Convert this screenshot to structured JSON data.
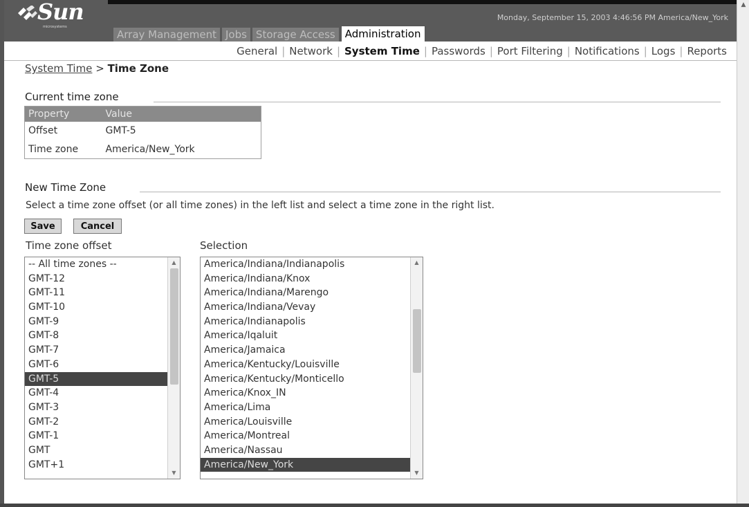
{
  "header": {
    "logo_text": "Sun",
    "logo_subtext": "microsystems",
    "datetime": "Monday, September 15, 2003 4:46:56 PM America/New_York"
  },
  "main_tabs": [
    {
      "label": "Array Management",
      "active": false
    },
    {
      "label": "Jobs",
      "active": false
    },
    {
      "label": "Storage Access",
      "active": false
    },
    {
      "label": "Administration",
      "active": true
    }
  ],
  "sub_tabs": [
    {
      "label": "General",
      "active": false
    },
    {
      "label": "Network",
      "active": false
    },
    {
      "label": "System Time",
      "active": true
    },
    {
      "label": "Passwords",
      "active": false
    },
    {
      "label": "Port Filtering",
      "active": false
    },
    {
      "label": "Notifications",
      "active": false
    },
    {
      "label": "Logs",
      "active": false
    },
    {
      "label": "Reports",
      "active": false
    }
  ],
  "breadcrumb": {
    "parent": "System Time",
    "separator": ">",
    "current": "Time Zone"
  },
  "current_tz": {
    "title": "Current time zone",
    "headers": [
      "Property",
      "Value"
    ],
    "rows": [
      [
        "Offset",
        "GMT-5"
      ],
      [
        "Time zone",
        "America/New_York"
      ]
    ]
  },
  "new_tz": {
    "title": "New Time Zone",
    "instructions": "Select a time zone offset (or all time zones) in the left list and select a time zone in the right list.",
    "save_label": "Save",
    "cancel_label": "Cancel",
    "offset_label": "Time zone offset",
    "selection_label": "Selection",
    "offsets": [
      "-- All time zones --",
      "GMT-12",
      "GMT-11",
      "GMT-10",
      "GMT-9",
      "GMT-8",
      "GMT-7",
      "GMT-6",
      "GMT-5",
      "GMT-4",
      "GMT-3",
      "GMT-2",
      "GMT-1",
      "GMT",
      "GMT+1"
    ],
    "selected_offset": "GMT-5",
    "zones": [
      "America/Indiana/Indianapolis",
      "America/Indiana/Knox",
      "America/Indiana/Marengo",
      "America/Indiana/Vevay",
      "America/Indianapolis",
      "America/Iqaluit",
      "America/Jamaica",
      "America/Kentucky/Louisville",
      "America/Kentucky/Monticello",
      "America/Knox_IN",
      "America/Lima",
      "America/Louisville",
      "America/Montreal",
      "America/Nassau",
      "America/New_York"
    ],
    "selected_zone": "America/New_York"
  }
}
